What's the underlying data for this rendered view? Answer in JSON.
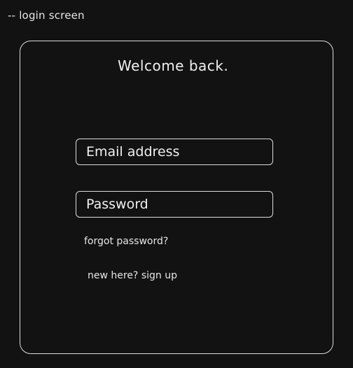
{
  "annotation": "-- login screen",
  "login_card": {
    "title": "Welcome back.",
    "email_placeholder": "Email address",
    "password_placeholder": "Password",
    "forgot_password_label": "forgot password?",
    "sign_up_label": "new here? sign up"
  }
}
